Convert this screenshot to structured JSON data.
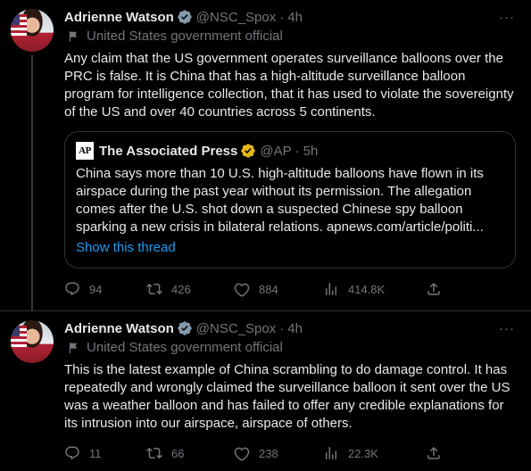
{
  "tweets": [
    {
      "author": {
        "name": "Adrienne Watson",
        "handle": "@NSC_Spox",
        "time": "4h"
      },
      "label": "United States government official",
      "text": "Any claim that the US government operates surveillance balloons over the PRC is false. It is China that has a high-altitude surveillance balloon program for intelligence collection, that it has used to violate the sovereignty of the US and over 40 countries across 5 continents.",
      "quote": {
        "logo": "AP",
        "name": "The Associated Press",
        "handle": "@AP",
        "time": "5h",
        "text": "China says more than 10 U.S. high-altitude balloons have flown in its airspace during the past year without its permission. The allegation comes after the U.S. shot down a suspected Chinese spy balloon sparking a new crisis in bilateral relations. apnews.com/article/politi...",
        "show_thread": "Show this thread"
      },
      "stats": {
        "replies": "94",
        "retweets": "426",
        "likes": "884",
        "views": "414.8K"
      }
    },
    {
      "author": {
        "name": "Adrienne Watson",
        "handle": "@NSC_Spox",
        "time": "4h"
      },
      "label": "United States government official",
      "text": "This is the latest example of China scrambling to do damage control. It has repeatedly and wrongly claimed the surveillance balloon it sent over the US was a weather balloon and has failed to offer any credible explanations for its intrusion into our airspace, airspace of others.",
      "stats": {
        "replies": "11",
        "retweets": "66",
        "likes": "238",
        "views": "22.3K"
      }
    }
  ],
  "icons": {
    "more": "more-icon",
    "verified": "verified-badge-icon",
    "label": "flag-icon",
    "reply": "reply-icon",
    "retweet": "retweet-icon",
    "like": "like-icon",
    "views": "views-icon",
    "share": "share-icon"
  },
  "colors": {
    "background": "#000000",
    "text": "#e7e9ea",
    "muted": "#71767b",
    "link": "#1d9bf0",
    "verified": "#829aab",
    "border": "#2f3336"
  }
}
